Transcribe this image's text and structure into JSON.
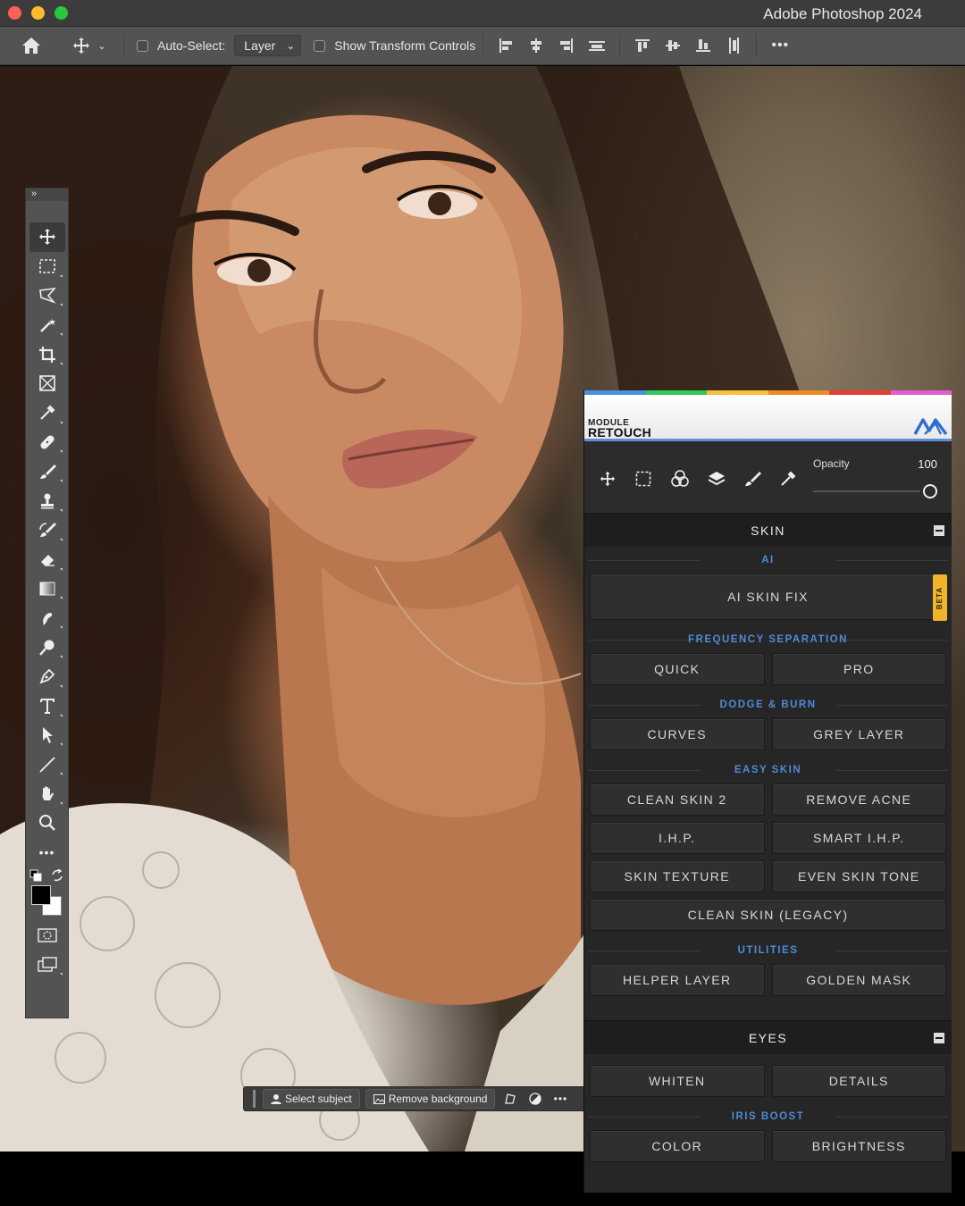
{
  "app": {
    "title": "Adobe Photoshop 2024"
  },
  "options_bar": {
    "auto_select_label": "Auto-Select:",
    "auto_select_value": "Layer",
    "transform_label": "Show Transform Controls",
    "more": "•••"
  },
  "toolbar": {
    "collapse": "»",
    "more": "•••"
  },
  "taskbar": {
    "select_subject": "Select subject",
    "remove_background": "Remove background",
    "more": "•••"
  },
  "panel": {
    "brand_line1": "MODULE",
    "brand_line2": "RETOUCH",
    "rainbow": [
      "#4a90e2",
      "#34c759",
      "#f7c23b",
      "#f08a24",
      "#e4402f",
      "#e05ed2"
    ],
    "opacity_label": "Opacity",
    "opacity_value": "100",
    "skin": {
      "title": "SKIN",
      "ai_label": "AI",
      "ai_skin_fix": "AI SKIN FIX",
      "beta": "BETA",
      "freq_label": "FREQUENCY SEPARATION",
      "quick": "QUICK",
      "pro": "PRO",
      "dodge_label": "DODGE & BURN",
      "curves": "CURVES",
      "grey_layer": "GREY LAYER",
      "easy_label": "EASY SKIN",
      "clean_skin_2": "CLEAN SKIN 2",
      "remove_acne": "REMOVE ACNE",
      "ihp": "I.H.P.",
      "smart_ihp": "SMART I.H.P.",
      "skin_texture": "SKIN TEXTURE",
      "even_skin_tone": "EVEN SKIN TONE",
      "clean_skin_legacy": "CLEAN SKIN (LEGACY)",
      "utilities_label": "UTILITIES",
      "helper_layer": "HELPER LAYER",
      "golden_mask": "GOLDEN MASK"
    },
    "eyes": {
      "title": "EYES",
      "whiten": "WHITEN",
      "details": "DETAILS",
      "iris_label": "IRIS BOOST",
      "color": "COLOR",
      "brightness": "BRIGHTNESS"
    }
  }
}
